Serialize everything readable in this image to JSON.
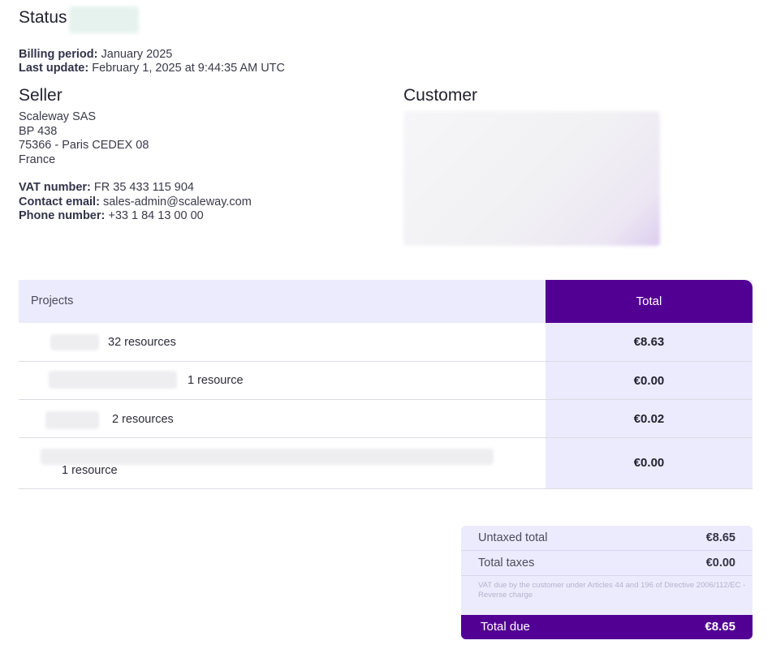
{
  "header": {
    "status_label": "Status",
    "billing_period_label": "Billing period:",
    "billing_period_value": "January 2025",
    "last_update_label": "Last update:",
    "last_update_value": "February 1, 2025 at 9:44:35 AM UTC"
  },
  "seller": {
    "title": "Seller",
    "address": [
      "Scaleway SAS",
      "BP 438",
      "75366 - Paris CEDEX 08",
      "France"
    ],
    "vat_label": "VAT number:",
    "vat_value": "FR 35 433 115 904",
    "email_label": "Contact email:",
    "email_value": "sales-admin@scaleway.com",
    "phone_label": "Phone number:",
    "phone_value": "+33 1 84 13 00 00"
  },
  "customer": {
    "title": "Customer"
  },
  "projects_table": {
    "header_projects": "Projects",
    "header_total": "Total",
    "rows": [
      {
        "resources": "32 resources",
        "total": "€8.63"
      },
      {
        "resources": "1 resource",
        "total": "€0.00"
      },
      {
        "resources": "2 resources",
        "total": "€0.02"
      },
      {
        "resources": "1 resource",
        "total": "€0.00"
      }
    ]
  },
  "summary": {
    "untaxed_label": "Untaxed total",
    "untaxed_value": "€8.65",
    "taxes_label": "Total taxes",
    "taxes_value": "€0.00",
    "vat_note": "VAT due by the customer under Articles 44 and 196 of Directive 2006/112/EC - Reverse charge",
    "total_due_label": "Total due",
    "total_due_value": "€8.65"
  },
  "colors": {
    "accent": "#520094",
    "table_tint": "#ecebfd"
  }
}
